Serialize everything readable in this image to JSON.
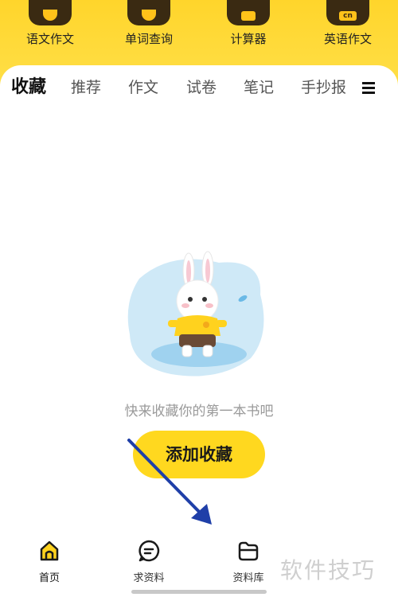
{
  "tools": [
    {
      "label": "语文作文",
      "icon": "pen-nib-icon"
    },
    {
      "label": "单词查询",
      "icon": "letter-a-search-icon"
    },
    {
      "label": "计算器",
      "icon": "calculator-icon"
    },
    {
      "label": "英语作文",
      "icon": "cn-badge-icon",
      "badge": "cn"
    }
  ],
  "tabs": [
    {
      "label": "收藏",
      "active": true
    },
    {
      "label": "推荐"
    },
    {
      "label": "作文"
    },
    {
      "label": "试卷"
    },
    {
      "label": "笔记"
    },
    {
      "label": "手抄报"
    }
  ],
  "empty_state": {
    "message": "快来收藏你的第一本书吧",
    "button": "添加收藏",
    "illustration": "bunny-mascot-illustration"
  },
  "bottom_nav": [
    {
      "label": "首页",
      "icon": "home-icon",
      "active": true
    },
    {
      "label": "求资料",
      "icon": "chat-bubble-icon"
    },
    {
      "label": "资料库",
      "icon": "folder-icon"
    }
  ],
  "watermark": "软件技巧",
  "colors": {
    "brand_yellow": "#ffd81f",
    "dark_brown": "#3a2a12",
    "annotation_arrow": "#1f3fa8"
  }
}
